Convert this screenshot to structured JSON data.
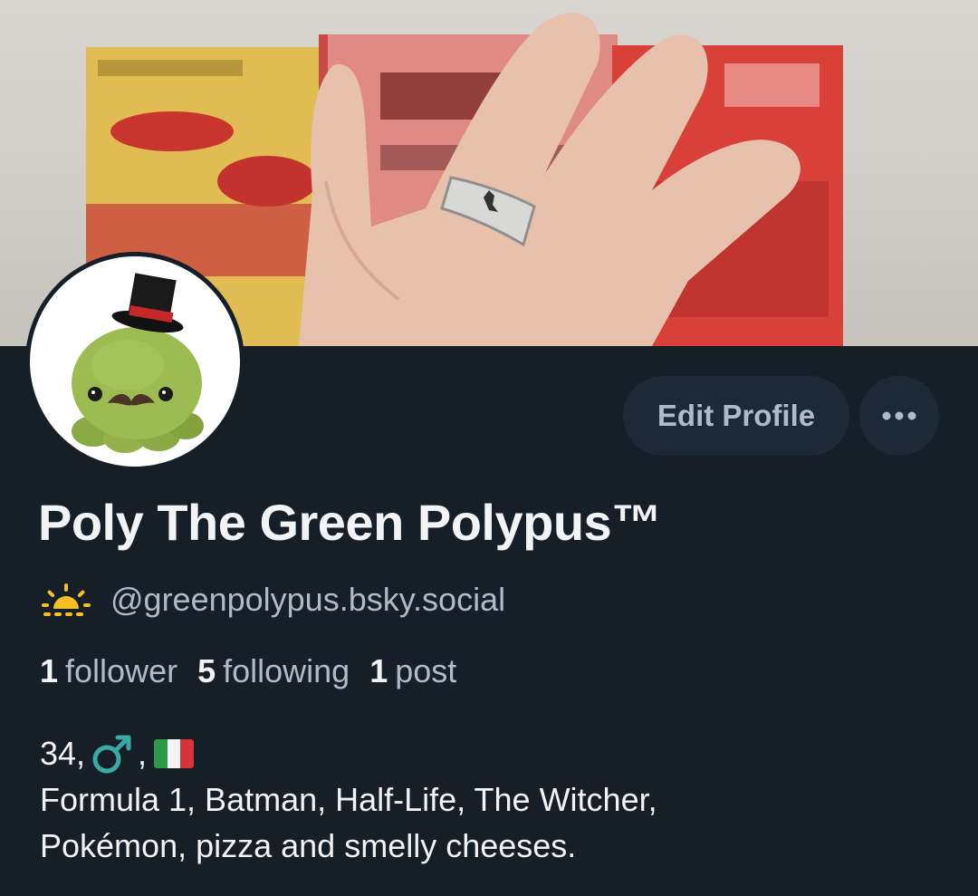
{
  "profile": {
    "display_name": "Poly The Green Polypus™",
    "handle": "@greenpolypus.bsky.social",
    "handle_icon": "sunrise-icon",
    "avatar_icon": "green-octopus-plush-with-top-hat",
    "banner_image": "hand-with-ferrari-ring-over-ferrari-books"
  },
  "actions": {
    "edit_label": "Edit Profile",
    "more_icon": "ellipsis-icon"
  },
  "stats": [
    {
      "count": "1",
      "label": "follower"
    },
    {
      "count": "5",
      "label": "following"
    },
    {
      "count": "1",
      "label": "post"
    }
  ],
  "bio": {
    "age_prefix": "34,",
    "gender_icon": "male-sign-icon",
    "flag_icon": "italy-flag-icon",
    "separator": ",",
    "line2": "Formula 1, Batman, Half-Life, The Witcher,",
    "line3": "Pokémon, pizza and smelly cheeses."
  },
  "colors": {
    "background": "#161e27",
    "button_bg": "#1e2936",
    "muted_text": "#aebbc9",
    "primary_text": "#f1f3f5",
    "male_sign": "#3aa8a4",
    "sun": "#f4c025"
  }
}
